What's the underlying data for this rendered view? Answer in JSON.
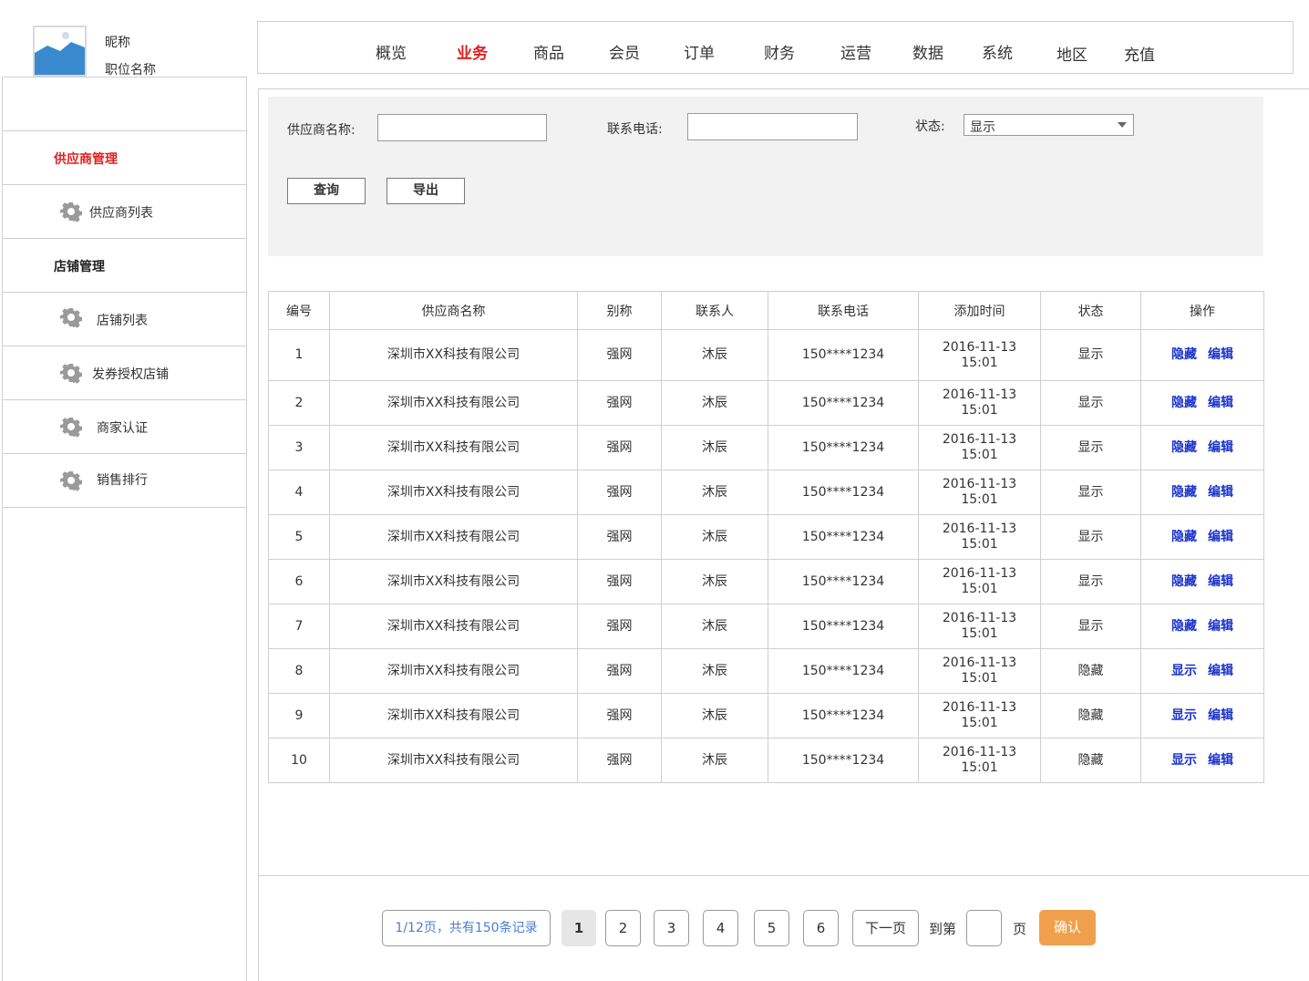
{
  "user": {
    "nickname": "昵称",
    "job_title": "职位名称"
  },
  "nav": {
    "active_color": "#e02020",
    "items": [
      "概览",
      "业务",
      "商品",
      "会员",
      "订单",
      "财务",
      "运营",
      "数据",
      "系统",
      "地区",
      "充值"
    ],
    "active": "业务"
  },
  "sidebar": {
    "groups": [
      {
        "label": "供应商管理",
        "active": true,
        "items": [
          {
            "label": "供应商列表",
            "icon": "gear-icon"
          }
        ]
      },
      {
        "label": "店铺管理",
        "active": false,
        "items": [
          {
            "label": "店铺列表",
            "icon": "gear-icon"
          },
          {
            "label": "发券授权店铺",
            "icon": "gear-icon"
          },
          {
            "label": "商家认证",
            "icon": "gear-icon"
          },
          {
            "label": "销售排行",
            "icon": "gear-icon"
          }
        ]
      }
    ]
  },
  "filter": {
    "name_label": "供应商名称:",
    "name_value": "",
    "phone_label": "联系电话:",
    "phone_value": "",
    "status_label": "状态:",
    "status_value": "显示",
    "query_button": "查询",
    "export_button": "导出"
  },
  "table": {
    "columns": [
      "编号",
      "供应商名称",
      "别称",
      "联系人",
      "联系电话",
      "添加时间",
      "状态",
      "操作"
    ],
    "rows": [
      {
        "id": "1",
        "name": "深圳市XX科技有限公司",
        "alias": "强网",
        "contact": "沐辰",
        "phone": "150****1234",
        "date": "2016-11-13",
        "time": "15:01",
        "status": "显示",
        "toggle": "隐藏",
        "edit": "编辑"
      },
      {
        "id": "2",
        "name": "深圳市XX科技有限公司",
        "alias": "强网",
        "contact": "沐辰",
        "phone": "150****1234",
        "date": "2016-11-13",
        "time": "15:01",
        "status": "显示",
        "toggle": "隐藏",
        "edit": "编辑"
      },
      {
        "id": "3",
        "name": "深圳市XX科技有限公司",
        "alias": "强网",
        "contact": "沐辰",
        "phone": "150****1234",
        "date": "2016-11-13",
        "time": "15:01",
        "status": "显示",
        "toggle": "隐藏",
        "edit": "编辑"
      },
      {
        "id": "4",
        "name": "深圳市XX科技有限公司",
        "alias": "强网",
        "contact": "沐辰",
        "phone": "150****1234",
        "date": "2016-11-13",
        "time": "15:01",
        "status": "显示",
        "toggle": "隐藏",
        "edit": "编辑"
      },
      {
        "id": "5",
        "name": "深圳市XX科技有限公司",
        "alias": "强网",
        "contact": "沐辰",
        "phone": "150****1234",
        "date": "2016-11-13",
        "time": "15:01",
        "status": "显示",
        "toggle": "隐藏",
        "edit": "编辑"
      },
      {
        "id": "6",
        "name": "深圳市XX科技有限公司",
        "alias": "强网",
        "contact": "沐辰",
        "phone": "150****1234",
        "date": "2016-11-13",
        "time": "15:01",
        "status": "显示",
        "toggle": "隐藏",
        "edit": "编辑"
      },
      {
        "id": "7",
        "name": "深圳市XX科技有限公司",
        "alias": "强网",
        "contact": "沐辰",
        "phone": "150****1234",
        "date": "2016-11-13",
        "time": "15:01",
        "status": "显示",
        "toggle": "隐藏",
        "edit": "编辑"
      },
      {
        "id": "8",
        "name": "深圳市XX科技有限公司",
        "alias": "强网",
        "contact": "沐辰",
        "phone": "150****1234",
        "date": "2016-11-13",
        "time": "15:01",
        "status": "隐藏",
        "toggle": "显示",
        "edit": "编辑"
      },
      {
        "id": "9",
        "name": "深圳市XX科技有限公司",
        "alias": "强网",
        "contact": "沐辰",
        "phone": "150****1234",
        "date": "2016-11-13",
        "time": "15:01",
        "status": "隐藏",
        "toggle": "显示",
        "edit": "编辑"
      },
      {
        "id": "10",
        "name": "深圳市XX科技有限公司",
        "alias": "强网",
        "contact": "沐辰",
        "phone": "150****1234",
        "date": "2016-11-13",
        "time": "15:01",
        "status": "隐藏",
        "toggle": "显示",
        "edit": "编辑"
      }
    ]
  },
  "pagination": {
    "info": "1/12页，共有150条记录",
    "pages": [
      "1",
      "2",
      "3",
      "4",
      "5",
      "6"
    ],
    "current": "1",
    "next": "下一页",
    "goto_prefix": "到第",
    "goto_suffix": "页",
    "goto_value": "",
    "confirm": "确认",
    "confirm_color": "#f0a04c"
  }
}
